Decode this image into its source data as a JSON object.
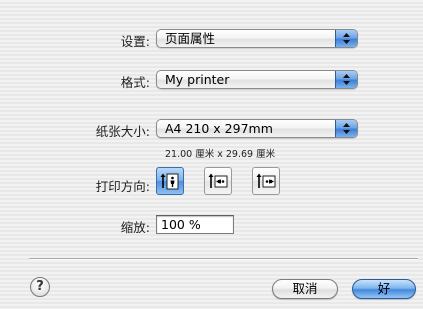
{
  "settings": {
    "label": "设置:",
    "value": "页面属性"
  },
  "format": {
    "label": "格式:",
    "value": "My printer"
  },
  "paper_size": {
    "label": "纸张大小:",
    "value": "A4 210 x 297mm",
    "detail": "21.00 厘米 x 29.69 厘米"
  },
  "orientation": {
    "label": "打印方向:",
    "options": [
      "portrait",
      "landscape-left",
      "landscape-right"
    ],
    "selected": "portrait"
  },
  "scale": {
    "label": "缩放:",
    "value": "100 %"
  },
  "buttons": {
    "help": "?",
    "cancel": "取消",
    "ok": "好"
  },
  "colors": {
    "accent": "#4f8fdf",
    "background": "#ededed"
  }
}
